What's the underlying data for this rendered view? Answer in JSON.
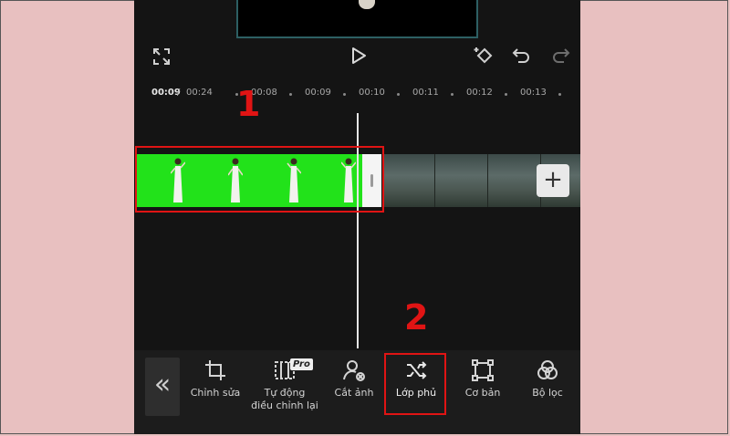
{
  "player": {
    "current_time": "00:09",
    "separator": " / ",
    "total_time": "00:24"
  },
  "ruler": {
    "ticks": [
      "00:08",
      "00:09",
      "00:10",
      "00:11",
      "00:12",
      "00:13"
    ]
  },
  "annotations": {
    "label_1": "1",
    "label_2": "2",
    "accent": "#e01414"
  },
  "timeline": {
    "add_label": "+",
    "overlay_color": "#22e21a"
  },
  "toolbar": {
    "collapse_icon": "«",
    "pro_badge": "Pro",
    "tools": [
      {
        "label": "Chỉnh sửa",
        "icon": "crop-icon"
      },
      {
        "label": "Tự động\nđiều chỉnh lại",
        "icon": "reframe-icon"
      },
      {
        "label": "Cắt ảnh",
        "icon": "cutout-icon"
      },
      {
        "label": "Lớp phủ",
        "icon": "overlay-icon"
      },
      {
        "label": "Cơ bản",
        "icon": "basic-icon"
      },
      {
        "label": "Bộ lọc",
        "icon": "filter-icon"
      }
    ]
  }
}
